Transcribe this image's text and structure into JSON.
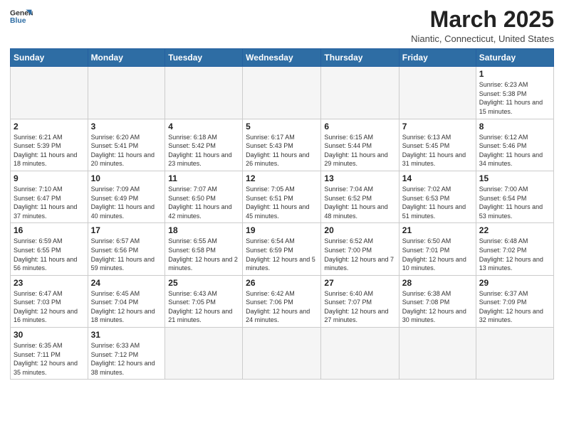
{
  "logo": {
    "line1": "General",
    "line2": "Blue"
  },
  "title": "March 2025",
  "subtitle": "Niantic, Connecticut, United States",
  "weekdays": [
    "Sunday",
    "Monday",
    "Tuesday",
    "Wednesday",
    "Thursday",
    "Friday",
    "Saturday"
  ],
  "weeks": [
    [
      {
        "day": "",
        "info": ""
      },
      {
        "day": "",
        "info": ""
      },
      {
        "day": "",
        "info": ""
      },
      {
        "day": "",
        "info": ""
      },
      {
        "day": "",
        "info": ""
      },
      {
        "day": "",
        "info": ""
      },
      {
        "day": "1",
        "info": "Sunrise: 6:23 AM\nSunset: 5:38 PM\nDaylight: 11 hours and 15 minutes."
      }
    ],
    [
      {
        "day": "2",
        "info": "Sunrise: 6:21 AM\nSunset: 5:39 PM\nDaylight: 11 hours and 18 minutes."
      },
      {
        "day": "3",
        "info": "Sunrise: 6:20 AM\nSunset: 5:41 PM\nDaylight: 11 hours and 20 minutes."
      },
      {
        "day": "4",
        "info": "Sunrise: 6:18 AM\nSunset: 5:42 PM\nDaylight: 11 hours and 23 minutes."
      },
      {
        "day": "5",
        "info": "Sunrise: 6:17 AM\nSunset: 5:43 PM\nDaylight: 11 hours and 26 minutes."
      },
      {
        "day": "6",
        "info": "Sunrise: 6:15 AM\nSunset: 5:44 PM\nDaylight: 11 hours and 29 minutes."
      },
      {
        "day": "7",
        "info": "Sunrise: 6:13 AM\nSunset: 5:45 PM\nDaylight: 11 hours and 31 minutes."
      },
      {
        "day": "8",
        "info": "Sunrise: 6:12 AM\nSunset: 5:46 PM\nDaylight: 11 hours and 34 minutes."
      }
    ],
    [
      {
        "day": "9",
        "info": "Sunrise: 7:10 AM\nSunset: 6:47 PM\nDaylight: 11 hours and 37 minutes."
      },
      {
        "day": "10",
        "info": "Sunrise: 7:09 AM\nSunset: 6:49 PM\nDaylight: 11 hours and 40 minutes."
      },
      {
        "day": "11",
        "info": "Sunrise: 7:07 AM\nSunset: 6:50 PM\nDaylight: 11 hours and 42 minutes."
      },
      {
        "day": "12",
        "info": "Sunrise: 7:05 AM\nSunset: 6:51 PM\nDaylight: 11 hours and 45 minutes."
      },
      {
        "day": "13",
        "info": "Sunrise: 7:04 AM\nSunset: 6:52 PM\nDaylight: 11 hours and 48 minutes."
      },
      {
        "day": "14",
        "info": "Sunrise: 7:02 AM\nSunset: 6:53 PM\nDaylight: 11 hours and 51 minutes."
      },
      {
        "day": "15",
        "info": "Sunrise: 7:00 AM\nSunset: 6:54 PM\nDaylight: 11 hours and 53 minutes."
      }
    ],
    [
      {
        "day": "16",
        "info": "Sunrise: 6:59 AM\nSunset: 6:55 PM\nDaylight: 11 hours and 56 minutes."
      },
      {
        "day": "17",
        "info": "Sunrise: 6:57 AM\nSunset: 6:56 PM\nDaylight: 11 hours and 59 minutes."
      },
      {
        "day": "18",
        "info": "Sunrise: 6:55 AM\nSunset: 6:58 PM\nDaylight: 12 hours and 2 minutes."
      },
      {
        "day": "19",
        "info": "Sunrise: 6:54 AM\nSunset: 6:59 PM\nDaylight: 12 hours and 5 minutes."
      },
      {
        "day": "20",
        "info": "Sunrise: 6:52 AM\nSunset: 7:00 PM\nDaylight: 12 hours and 7 minutes."
      },
      {
        "day": "21",
        "info": "Sunrise: 6:50 AM\nSunset: 7:01 PM\nDaylight: 12 hours and 10 minutes."
      },
      {
        "day": "22",
        "info": "Sunrise: 6:48 AM\nSunset: 7:02 PM\nDaylight: 12 hours and 13 minutes."
      }
    ],
    [
      {
        "day": "23",
        "info": "Sunrise: 6:47 AM\nSunset: 7:03 PM\nDaylight: 12 hours and 16 minutes."
      },
      {
        "day": "24",
        "info": "Sunrise: 6:45 AM\nSunset: 7:04 PM\nDaylight: 12 hours and 18 minutes."
      },
      {
        "day": "25",
        "info": "Sunrise: 6:43 AM\nSunset: 7:05 PM\nDaylight: 12 hours and 21 minutes."
      },
      {
        "day": "26",
        "info": "Sunrise: 6:42 AM\nSunset: 7:06 PM\nDaylight: 12 hours and 24 minutes."
      },
      {
        "day": "27",
        "info": "Sunrise: 6:40 AM\nSunset: 7:07 PM\nDaylight: 12 hours and 27 minutes."
      },
      {
        "day": "28",
        "info": "Sunrise: 6:38 AM\nSunset: 7:08 PM\nDaylight: 12 hours and 30 minutes."
      },
      {
        "day": "29",
        "info": "Sunrise: 6:37 AM\nSunset: 7:09 PM\nDaylight: 12 hours and 32 minutes."
      }
    ],
    [
      {
        "day": "30",
        "info": "Sunrise: 6:35 AM\nSunset: 7:11 PM\nDaylight: 12 hours and 35 minutes."
      },
      {
        "day": "31",
        "info": "Sunrise: 6:33 AM\nSunset: 7:12 PM\nDaylight: 12 hours and 38 minutes."
      },
      {
        "day": "",
        "info": ""
      },
      {
        "day": "",
        "info": ""
      },
      {
        "day": "",
        "info": ""
      },
      {
        "day": "",
        "info": ""
      },
      {
        "day": "",
        "info": ""
      }
    ]
  ]
}
